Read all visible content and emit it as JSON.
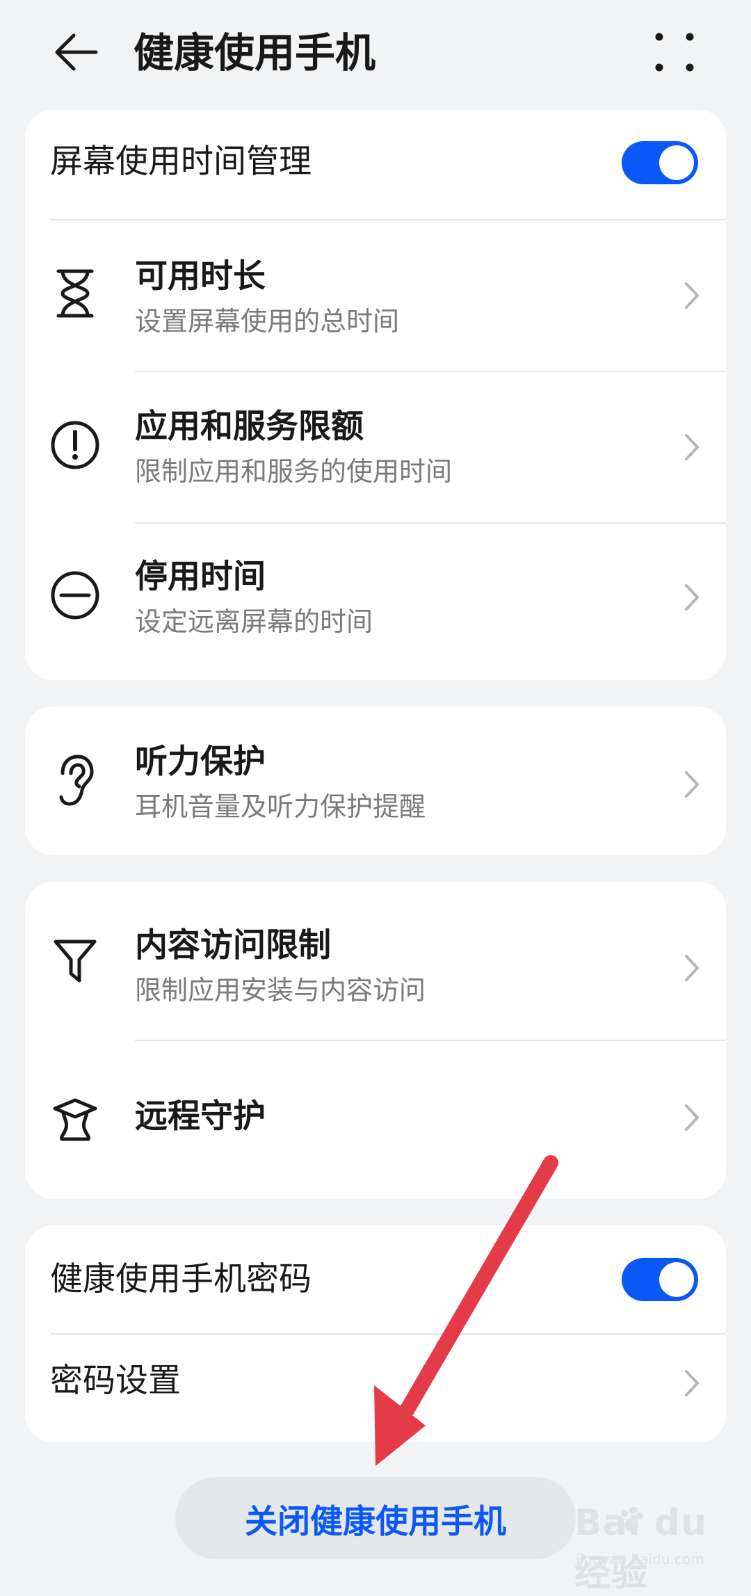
{
  "header": {
    "title": "健康使用手机",
    "back_icon": "back-arrow-icon",
    "more_icon": "more-dots-icon"
  },
  "screen_time_card": {
    "toggle_label": "屏幕使用时间管理",
    "toggle_on": true,
    "items": [
      {
        "title": "可用时长",
        "subtitle": "设置屏幕使用的总时间",
        "icon": "hourglass-icon"
      },
      {
        "title": "应用和服务限额",
        "subtitle": "限制应用和服务的使用时间",
        "icon": "exclamation-circle-icon"
      },
      {
        "title": "停用时间",
        "subtitle": "设定远离屏幕的时间",
        "icon": "minus-circle-icon"
      }
    ]
  },
  "hearing_card": {
    "items": [
      {
        "title": "听力保护",
        "subtitle": "耳机音量及听力保护提醒",
        "icon": "ear-icon"
      }
    ]
  },
  "content_card": {
    "items": [
      {
        "title": "内容访问限制",
        "subtitle": "限制应用安装与内容访问",
        "icon": "filter-icon"
      },
      {
        "title": "远程守护",
        "icon": "graduation-cap-icon"
      }
    ]
  },
  "password_card": {
    "toggle_label": "健康使用手机密码",
    "toggle_on": true,
    "settings_label": "密码设置"
  },
  "footer": {
    "close_button": "关闭健康使用手机"
  },
  "watermark": {
    "logo_text": "Bai du 经验",
    "url": "jingyan.baidu.com"
  },
  "colors": {
    "accent": "#0a59f7",
    "background": "#f1f3f5",
    "card": "#ffffff",
    "annotation_arrow": "#e53a48"
  }
}
